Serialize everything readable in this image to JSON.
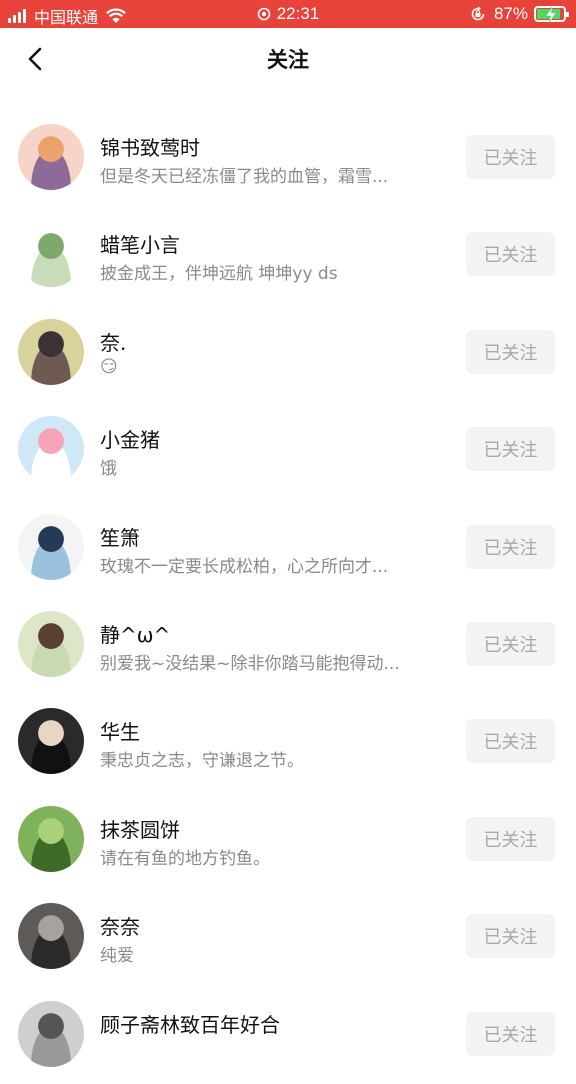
{
  "status_bar": {
    "carrier": "中国联通",
    "time": "22:31",
    "battery_percent": "87%",
    "battery_level": 0.87,
    "icons": [
      "signal-icon",
      "wifi-icon",
      "location-icon",
      "rotation-lock-icon",
      "battery-charging-icon"
    ]
  },
  "header": {
    "title": "关注",
    "back_icon": "chevron-left-icon"
  },
  "follow_list": [
    {
      "name": "锦书致莺时",
      "bio": "但是冬天已经冻僵了我的血管，霜雪...",
      "button": "已关注",
      "avatar_colors": [
        "#f6d5c8",
        "#e9a36b",
        "#8e6a9b"
      ]
    },
    {
      "name": "蜡笔小言",
      "bio": "披金成王，伴坤远航 坤坤yy ds",
      "button": "已关注",
      "avatar_colors": [
        "#ffffff",
        "#7fa86b",
        "#c9dcb9"
      ]
    },
    {
      "name": "奈.",
      "bio": "😏",
      "button": "已关注",
      "avatar_colors": [
        "#d7d39a",
        "#3a3234",
        "#6e5a52"
      ]
    },
    {
      "name": "小金猪",
      "bio": "饿",
      "button": "已关注",
      "avatar_colors": [
        "#cfe8f5",
        "#f6a4b7",
        "#ffffff"
      ]
    },
    {
      "name": "笙箫",
      "bio": "玫瑰不一定要长成松柏，心之所向才...",
      "button": "已关注",
      "avatar_colors": [
        "#f4f4f4",
        "#253a56",
        "#9bc1df"
      ]
    },
    {
      "name": "静^ω^",
      "bio": "别爱我~没结果~除非你踏马能抱得动...",
      "button": "已关注",
      "avatar_colors": [
        "#dde7c8",
        "#5a4032",
        "#c9d9b2"
      ]
    },
    {
      "name": "华生",
      "bio": "秉忠贞之志，守谦退之节。",
      "button": "已关注",
      "avatar_colors": [
        "#2a2a2a",
        "#e8d6c5",
        "#111111"
      ]
    },
    {
      "name": "抹茶圆饼",
      "bio": "请在有鱼的地方钓鱼。",
      "button": "已关注",
      "avatar_colors": [
        "#7fb25a",
        "#a9d17c",
        "#3f6b2a"
      ]
    },
    {
      "name": "奈奈",
      "bio": "纯爱",
      "button": "已关注",
      "avatar_colors": [
        "#5d5a57",
        "#a7a29b",
        "#2d2b29"
      ]
    },
    {
      "name": "顾子斋林致百年好合",
      "bio": "",
      "button": "已关注",
      "avatar_colors": [
        "#cfcfcf",
        "#555555",
        "#999999"
      ]
    }
  ],
  "colors": {
    "status_bar": "#e8433b",
    "button_bg": "#f3f3f3",
    "button_text": "#a8a8a8",
    "bio_text": "#8a8a8a"
  }
}
